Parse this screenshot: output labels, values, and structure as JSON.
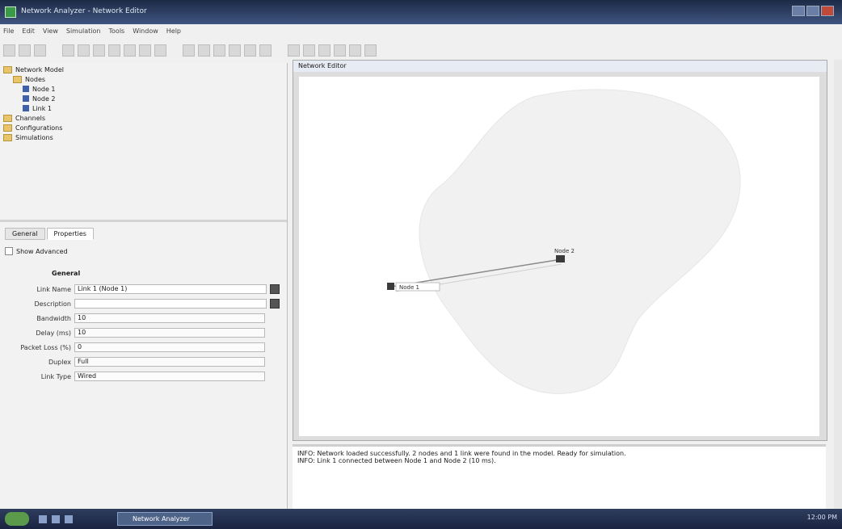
{
  "window": {
    "title": "Network Analyzer - Network Editor"
  },
  "menu": [
    "File",
    "Edit",
    "View",
    "Simulation",
    "Tools",
    "Window",
    "Help"
  ],
  "toolbar": {
    "buttons": [
      "new",
      "open",
      "save",
      "print",
      "cut",
      "copy",
      "paste",
      "delete",
      "undo",
      "redo",
      "zoom-in",
      "zoom-out",
      "fit",
      "run",
      "stop",
      "step",
      "validate",
      "export",
      "import",
      "pan",
      "select",
      "node"
    ]
  },
  "tree": {
    "items": [
      {
        "label": "Network Model",
        "kind": "folder",
        "indent": 0
      },
      {
        "label": "Nodes",
        "kind": "folder",
        "indent": 1
      },
      {
        "label": "Node 1",
        "kind": "node",
        "indent": 2
      },
      {
        "label": "Node 2",
        "kind": "node",
        "indent": 2
      },
      {
        "label": "Link 1",
        "kind": "node",
        "indent": 2
      },
      {
        "label": "Channels",
        "kind": "folder",
        "indent": 0
      },
      {
        "label": "Configurations",
        "kind": "folder",
        "indent": 0
      },
      {
        "label": "Simulations",
        "kind": "folder",
        "indent": 0
      }
    ]
  },
  "properties": {
    "tabs": [
      "General",
      "Properties"
    ],
    "active_tab": 1,
    "subtitle": "Show Advanced",
    "section": "General",
    "rows": [
      {
        "label": "Link Name",
        "value": "Link 1 (Node 1)",
        "type": "text",
        "button": true
      },
      {
        "label": "Description",
        "value": "",
        "type": "text",
        "button": true
      },
      {
        "label": "Bandwidth",
        "value": "10",
        "type": "select"
      },
      {
        "label": "Delay (ms)",
        "value": "10",
        "type": "select"
      },
      {
        "label": "Packet Loss (%)",
        "value": "0",
        "type": "select"
      },
      {
        "label": "Duplex",
        "value": "Full",
        "type": "select"
      },
      {
        "label": "Link Type",
        "value": "Wired",
        "type": "select"
      }
    ]
  },
  "canvas": {
    "title": "Network Editor",
    "nodes": [
      "Node 2",
      "Node 1"
    ]
  },
  "console": {
    "lines": [
      "INFO: Network loaded successfully. 2 nodes and 1 link were found in the model. Ready for simulation.",
      "INFO: Link 1 connected between Node 1 and Node 2 (10 ms)."
    ]
  },
  "taskbar": {
    "task": "Network Analyzer",
    "clock": "12:00 PM"
  },
  "colors": {
    "titlebar": "#1d2a46",
    "canvas_bg": "#ffffff",
    "blob": "#f0f0f0",
    "node": "#3a3a3a"
  }
}
